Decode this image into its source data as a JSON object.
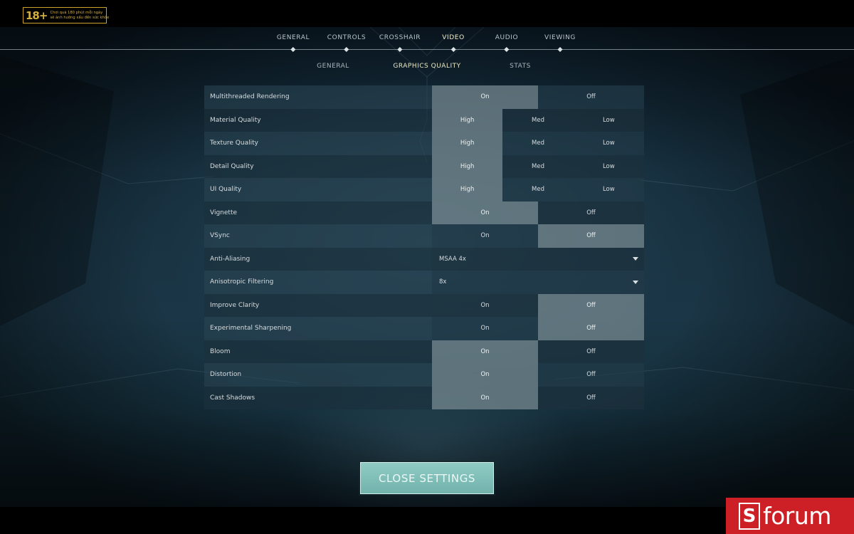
{
  "age_rating": {
    "number": "18+",
    "line1": "Chơi quá 180 phút mỗi ngày",
    "line2": "sẽ ảnh hưởng xấu đến sức khỏe"
  },
  "main_tabs": [
    {
      "label": "GENERAL",
      "active": false
    },
    {
      "label": "CONTROLS",
      "active": false
    },
    {
      "label": "CROSSHAIR",
      "active": false
    },
    {
      "label": "VIDEO",
      "active": true
    },
    {
      "label": "AUDIO",
      "active": false
    },
    {
      "label": "VIEWING",
      "active": false
    }
  ],
  "sub_tabs": [
    {
      "label": "GENERAL",
      "active": false
    },
    {
      "label": "GRAPHICS QUALITY",
      "active": true
    },
    {
      "label": "STATS",
      "active": false
    }
  ],
  "settings": [
    {
      "label": "Multithreaded Rendering",
      "type": "toggle",
      "options": [
        "On",
        "Off"
      ],
      "selected": "On"
    },
    {
      "label": "Material Quality",
      "type": "toggle",
      "options": [
        "High",
        "Med",
        "Low"
      ],
      "selected": "High"
    },
    {
      "label": "Texture Quality",
      "type": "toggle",
      "options": [
        "High",
        "Med",
        "Low"
      ],
      "selected": "High"
    },
    {
      "label": "Detail Quality",
      "type": "toggle",
      "options": [
        "High",
        "Med",
        "Low"
      ],
      "selected": "High"
    },
    {
      "label": "UI Quality",
      "type": "toggle",
      "options": [
        "High",
        "Med",
        "Low"
      ],
      "selected": "High"
    },
    {
      "label": "Vignette",
      "type": "toggle",
      "options": [
        "On",
        "Off"
      ],
      "selected": "On"
    },
    {
      "label": "VSync",
      "type": "toggle",
      "options": [
        "On",
        "Off"
      ],
      "selected": "Off"
    },
    {
      "label": "Anti-Aliasing",
      "type": "dropdown",
      "value": "MSAA 4x"
    },
    {
      "label": "Anisotropic Filtering",
      "type": "dropdown",
      "value": "8x"
    },
    {
      "label": "Improve Clarity",
      "type": "toggle",
      "options": [
        "On",
        "Off"
      ],
      "selected": "Off"
    },
    {
      "label": "Experimental Sharpening",
      "type": "toggle",
      "options": [
        "On",
        "Off"
      ],
      "selected": "Off"
    },
    {
      "label": "Bloom",
      "type": "toggle",
      "options": [
        "On",
        "Off"
      ],
      "selected": "On"
    },
    {
      "label": "Distortion",
      "type": "toggle",
      "options": [
        "On",
        "Off"
      ],
      "selected": "On"
    },
    {
      "label": "Cast Shadows",
      "type": "toggle",
      "options": [
        "On",
        "Off"
      ],
      "selected": "On"
    }
  ],
  "close_button": {
    "label": "CLOSE SETTINGS"
  },
  "watermark": {
    "logo_letter": "S",
    "text": "forum"
  },
  "colors": {
    "accent_teal": "#7fbfb8",
    "active_tab": "#f2efcf",
    "watermark_red": "#cc1f26"
  }
}
